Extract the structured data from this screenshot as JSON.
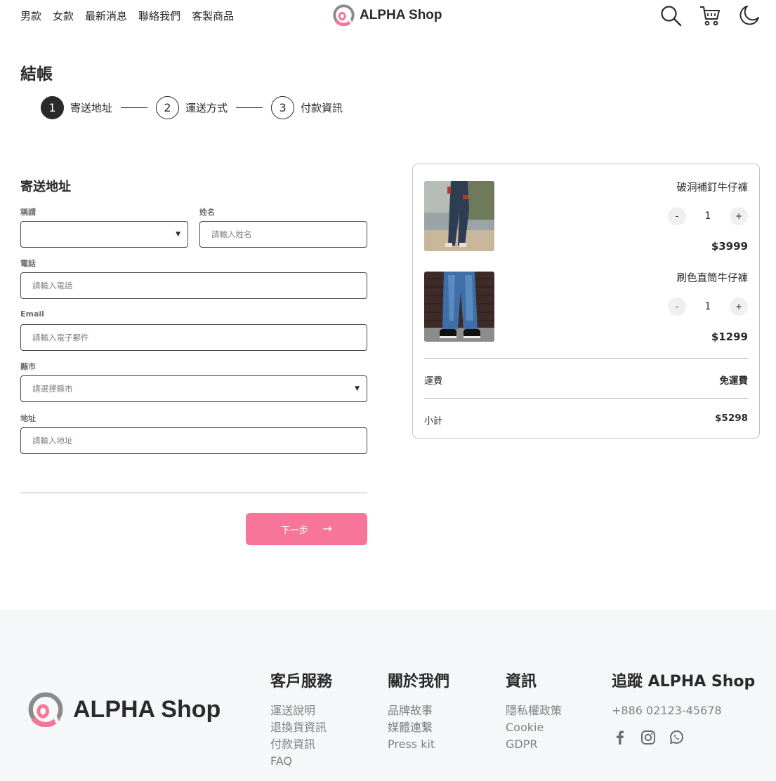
{
  "header": {
    "nav": [
      "男款",
      "女款",
      "最新消息",
      "聯絡我們",
      "客製商品"
    ],
    "logo_text": "ALPHA Shop",
    "icons": [
      "search-icon",
      "cart-icon",
      "moon-icon"
    ]
  },
  "page": {
    "title": "結帳"
  },
  "stepper": [
    {
      "number": "1",
      "label": "寄送地址",
      "active": true
    },
    {
      "number": "2",
      "label": "運送方式",
      "active": false
    },
    {
      "number": "3",
      "label": "付款資訊",
      "active": false
    }
  ],
  "form": {
    "title": "寄送地址",
    "salutation": {
      "label": "稱謂",
      "value": ""
    },
    "name": {
      "label": "姓名",
      "placeholder": "請輸入姓名"
    },
    "phone": {
      "label": "電話",
      "placeholder": "請輸入電話"
    },
    "email": {
      "label": "Email",
      "placeholder": "請輸入電子郵件"
    },
    "city": {
      "label": "縣市",
      "value": "請選擇縣市"
    },
    "address": {
      "label": "地址",
      "placeholder": "請輸入地址"
    },
    "next_label": "下一步",
    "next_arrow": "→"
  },
  "cart": {
    "items": [
      {
        "name": "破洞補釘牛仔褲",
        "quantity": "1",
        "price": "$3999",
        "minus": "-",
        "plus": "+"
      },
      {
        "name": "刷色直筒牛仔褲",
        "quantity": "1",
        "price": "$1299",
        "minus": "-",
        "plus": "+"
      }
    ],
    "shipping_label": "運費",
    "shipping_value": "免運費",
    "subtotal_label": "小計",
    "subtotal_value": "$5298"
  },
  "footer": {
    "logo_text": "ALPHA Shop",
    "customer_service": {
      "title": "客戶服務",
      "links": [
        "運送說明",
        "退換貨資訊",
        "付款資訊",
        "FAQ"
      ]
    },
    "about": {
      "title": "關於我們",
      "links": [
        "品牌故事",
        "媒體連繫",
        "Press kit"
      ]
    },
    "info": {
      "title": "資訊",
      "links": [
        "隱私權政策",
        "Cookie",
        "GDPR"
      ]
    },
    "follow": {
      "title": "追蹤 ALPHA Shop",
      "phone": "+886 02123-45678",
      "social": [
        "facebook-icon",
        "instagram-icon",
        "whatsapp-icon"
      ]
    }
  },
  "colors": {
    "accent": "#f67599",
    "logo_pink": "#f67599",
    "logo_gray": "#8a8a8a",
    "text": "#2a2a2a",
    "footer_bg": "#f6f7f8"
  }
}
